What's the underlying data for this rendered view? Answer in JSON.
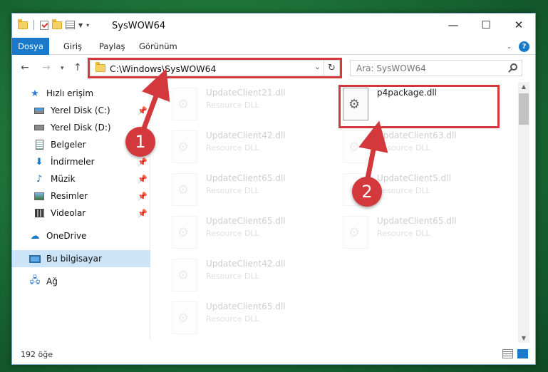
{
  "window": {
    "title": "SysWOW64",
    "controls": {
      "minimize": "—",
      "maximize": "☐",
      "close": "✕"
    }
  },
  "ribbon": {
    "tabs": [
      {
        "label": "Dosya"
      },
      {
        "label": "Giriş"
      },
      {
        "label": "Paylaş"
      },
      {
        "label": "Görünüm"
      }
    ],
    "help": "?"
  },
  "address": {
    "path": "C:\\Windows\\SysWOW64",
    "search_placeholder": "Ara: SysWOW64"
  },
  "sidebar": {
    "items": [
      {
        "label": "Hızlı erişim",
        "icon": "star-icon"
      },
      {
        "label": "Yerel Disk (C:)",
        "icon": "drive-icon",
        "pinned": true
      },
      {
        "label": "Yerel Disk (D:)",
        "icon": "drive-icon"
      },
      {
        "label": "Belgeler",
        "icon": "documents-icon"
      },
      {
        "label": "İndirmeler",
        "icon": "downloads-icon",
        "pinned": true
      },
      {
        "label": "Müzik",
        "icon": "music-icon",
        "pinned": true
      },
      {
        "label": "Resimler",
        "icon": "pictures-icon",
        "pinned": true
      },
      {
        "label": "Videolar",
        "icon": "videos-icon",
        "pinned": true
      },
      {
        "label": "OneDrive",
        "icon": "onedrive-icon"
      },
      {
        "label": "Bu bilgisayar",
        "icon": "this-pc-icon",
        "selected": true
      },
      {
        "label": "Ağ",
        "icon": "network-icon"
      }
    ]
  },
  "files": [
    {
      "name": "UpdateClient21.dll",
      "type": "Resource DLL"
    },
    {
      "name": "p4package.dll",
      "type": "",
      "highlighted": true
    },
    {
      "name": "UpdateClient42.dll",
      "type": "Resource DLL"
    },
    {
      "name": "UpdateClient63.dll",
      "type": "Resource DLL"
    },
    {
      "name": "UpdateClient65.dll",
      "type": "Resource DLL"
    },
    {
      "name": "UpdateClient5.dll",
      "type": "Resource DLL"
    },
    {
      "name": "UpdateClient65.dll",
      "type": "Resource DLL"
    },
    {
      "name": "UpdateClient65.dll",
      "type": "Resource DLL"
    },
    {
      "name": "UpdateClient42.dll",
      "type": "Resource DLL"
    },
    {
      "name": "UpdateClient65.dll",
      "type": "Resource DLL"
    }
  ],
  "status": {
    "item_count": "192 öğe"
  },
  "callouts": {
    "one": "1",
    "two": "2"
  },
  "colors": {
    "accent": "#1979ca",
    "callout": "#d2383c",
    "selection": "#cce4f7"
  }
}
